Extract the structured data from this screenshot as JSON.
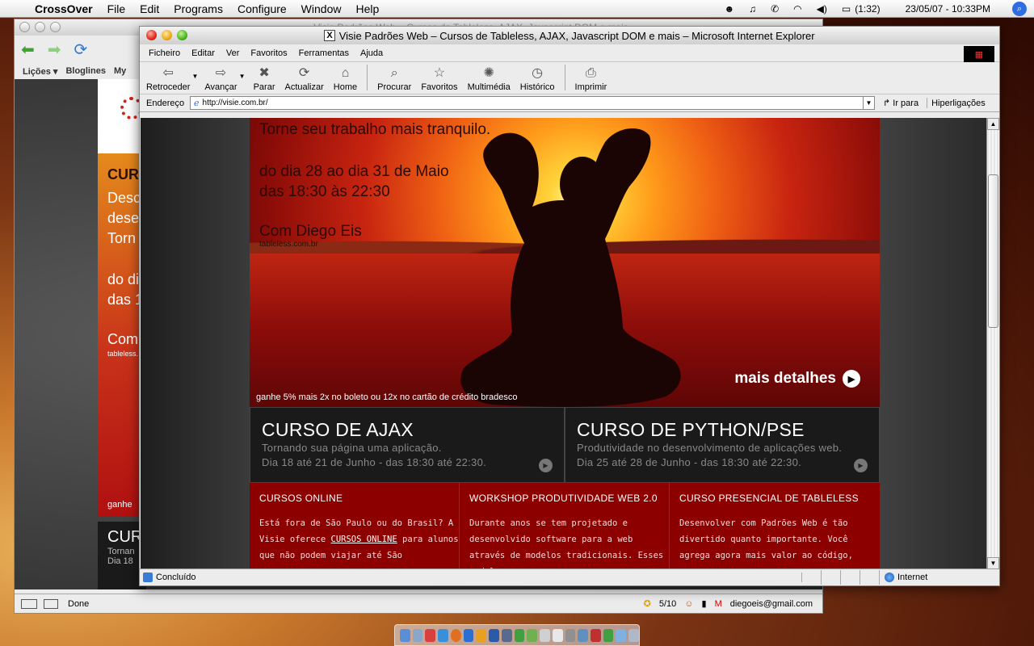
{
  "menubar": {
    "app": "CrossOver",
    "items": [
      "File",
      "Edit",
      "Programs",
      "Configure",
      "Window",
      "Help"
    ],
    "battery": "(1:32)",
    "datetime": "23/05/07 - 10:33PM"
  },
  "firefox": {
    "title": "Visie Padrões Web – Cursos de Tableless, AJAX, Javascript DOM e mais",
    "bookmarks": [
      "Lições ▾",
      "Bloglines",
      "My"
    ],
    "status": "Done",
    "counter": "5/10",
    "email": "diegoeis@gmail.com",
    "page_fragments": {
      "heading": "CUR",
      "lines": [
        "Desc",
        "deser",
        "Torn"
      ],
      "date_lines": [
        "do di",
        "das 1"
      ],
      "com": "Com",
      "site": "tableless.",
      "promo": "ganhe 5%",
      "dark_heading": "CUR",
      "dark_lines": [
        "Tornan",
        "Dia 18"
      ]
    }
  },
  "ie": {
    "title_icon": "X",
    "title": "Visie Padrões Web – Cursos de Tableless, AJAX, Javascript DOM e mais – Microsoft Internet Explorer",
    "menu": [
      "Ficheiro",
      "Editar",
      "Ver",
      "Favoritos",
      "Ferramentas",
      "Ajuda"
    ],
    "toolbar": [
      {
        "label": "Retroceder",
        "icon": "back-arrow-icon",
        "glyph": "⇦"
      },
      {
        "label": "Avançar",
        "icon": "forward-arrow-icon",
        "glyph": "⇨"
      },
      {
        "label": "Parar",
        "icon": "stop-icon",
        "glyph": "✖"
      },
      {
        "label": "Actualizar",
        "icon": "refresh-icon",
        "glyph": "⟳"
      },
      {
        "label": "Home",
        "icon": "home-icon",
        "glyph": "⌂"
      },
      {
        "label": "Procurar",
        "icon": "search-icon",
        "glyph": "⌕"
      },
      {
        "label": "Favoritos",
        "icon": "favorites-icon",
        "glyph": "☆"
      },
      {
        "label": "Multimédia",
        "icon": "multimedia-icon",
        "glyph": "✺"
      },
      {
        "label": "Histórico",
        "icon": "history-icon",
        "glyph": "◷"
      },
      {
        "label": "Imprimir",
        "icon": "print-icon",
        "glyph": "⎙"
      }
    ],
    "address_label": "Endereço",
    "url": "http://visie.com.br/",
    "go_label": "Ir para",
    "links_label": "Hiperligações",
    "status": "Concluído",
    "zone": "Internet"
  },
  "page": {
    "hero": {
      "tagline": "Torne seu trabalho mais tranquilo.",
      "dates": [
        "do dia 28 ao dia 31 de Maio",
        "das 18:30 às 22:30"
      ],
      "with": "Com Diego Eis",
      "site": "tableless.com.br",
      "promo": "ganhe 5% mais 2x no boleto ou 12x no cartão de crédito bradesco",
      "more": "mais detalhes"
    },
    "courses": [
      {
        "title": "CURSO DE AJAX",
        "subtitle": "Tornando sua página uma aplicação.",
        "dates": "Dia 18 até 21 de Junho - das 18:30 até 22:30."
      },
      {
        "title": "CURSO DE PYTHON/PSE",
        "subtitle": "Produtividade no desenvolvimento de aplicações web.",
        "dates": "Dia 25 até 28 de Junho - das 18:30 até 22:30."
      }
    ],
    "boxes": [
      {
        "title": "CURSOS ONLINE",
        "pre": "Está fora de São Paulo ou do Brasil? A Visie oferece ",
        "link": "CURSOS ONLINE",
        "post": " para alunos que não podem viajar até São"
      },
      {
        "title": "WORKSHOP PRODUTIVIDADE WEB 2.0",
        "pre": "Durante anos se tem projetado e desenvolvido software para a web através de modelos tradicionais. Esses modelos",
        "link": "",
        "post": ""
      },
      {
        "title": "CURSO PRESENCIAL DE TABLELESS",
        "pre": "Desenvolver com Padrões Web é tão divertido quanto importante. Você agrega agora mais valor ao código, pensa em",
        "link": "",
        "post": ""
      }
    ]
  }
}
